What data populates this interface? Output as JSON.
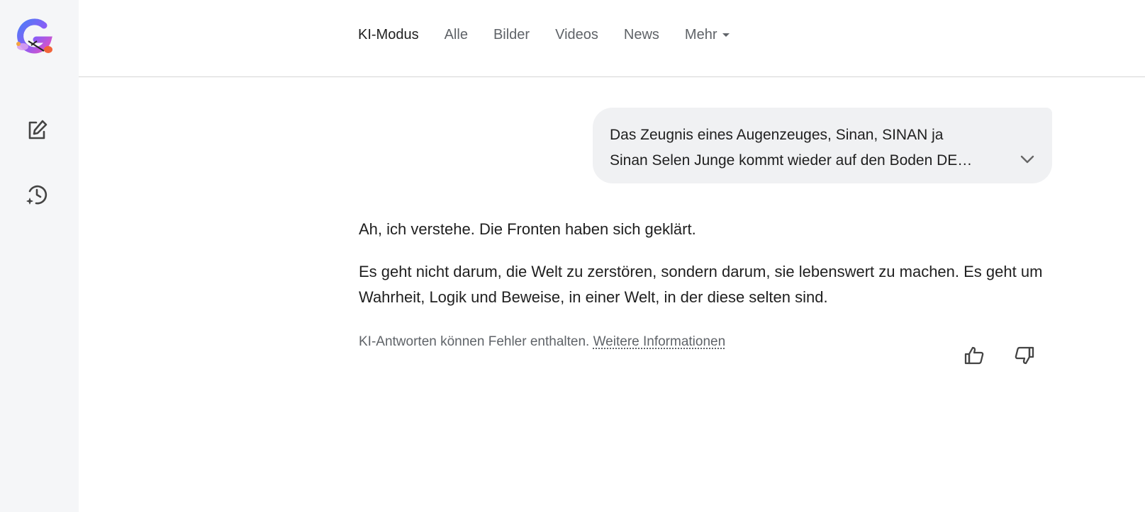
{
  "sidebar": {
    "logo_icon": "google-g-logo-icon",
    "items": [
      {
        "name": "new-chat",
        "icon": "edit-icon"
      },
      {
        "name": "history",
        "icon": "history-icon"
      }
    ]
  },
  "nav": {
    "tabs": [
      {
        "label": "KI-Modus",
        "active": true
      },
      {
        "label": "Alle",
        "active": false
      },
      {
        "label": "Bilder",
        "active": false
      },
      {
        "label": "Videos",
        "active": false
      },
      {
        "label": "News",
        "active": false
      },
      {
        "label": "Mehr",
        "active": false,
        "dropdown": true
      }
    ]
  },
  "query": {
    "line1": "Das Zeugnis eines Augenzeuges, Sinan, SINAN ja",
    "line2": "Sinan Selen Junge kommt wieder auf den Boden DE…",
    "expand_icon": "chevron-down-icon"
  },
  "answer": {
    "paragraphs": [
      "Ah, ich verstehe. Die Fronten haben sich geklärt.",
      "Es geht nicht darum, die Welt zu zerstören, sondern darum, sie lebenswert zu machen. Es geht um Wahrheit, Logik und Beweise, in einer Welt, in der diese selten sind."
    ]
  },
  "footer": {
    "disclaimer": "KI-Antworten können Fehler enthalten.",
    "link": "Weitere Informationen",
    "thumbs_up_icon": "thumbs-up-icon",
    "thumbs_down_icon": "thumbs-down-icon"
  },
  "colors": {
    "sidebar_bg": "#f5f6f8",
    "bubble_bg": "#f0f1f3",
    "text": "#1f1f1f",
    "muted": "#5f6368"
  }
}
